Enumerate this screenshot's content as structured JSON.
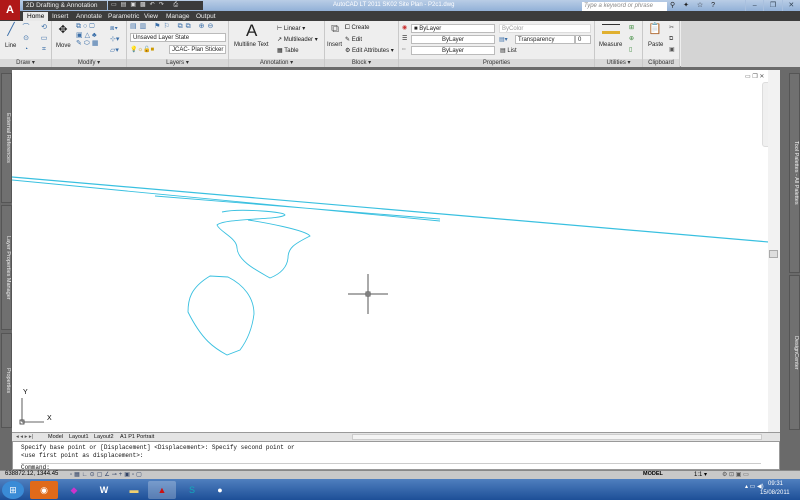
{
  "app": {
    "title": "AutoCAD LT 2011    SK02 Site Plan - P2c1.dwg",
    "workspace": "2D Drafting & Annotation",
    "search_placeholder": "Type a keyword or phrase",
    "app_button": "A"
  },
  "tabs": [
    "Home",
    "Insert",
    "Annotate",
    "Parametric",
    "View",
    "Manage",
    "Output"
  ],
  "active_tab": "Home",
  "panels": {
    "draw": {
      "label": "Draw ▾",
      "line": "Line"
    },
    "modify": {
      "label": "Modify ▾",
      "move": "Move"
    },
    "layers": {
      "label": "Layers ▾",
      "layer_state": "Unsaved Layer State",
      "current_layer": "JCAC- Plan Sticker"
    },
    "annotation": {
      "label": "Annotation ▾",
      "multiline_text": "Multiline Text",
      "linear": "Linear ▾",
      "multileader": "Multileader ▾",
      "table": "Table"
    },
    "block": {
      "label": "Block ▾",
      "insert": "Insert",
      "create": "Create",
      "edit": "Edit",
      "edit_attributes": "Edit Attributes ▾"
    },
    "properties": {
      "label": "Properties",
      "color": "ByLayer",
      "lineweight": "ByLayer",
      "linetype": "ByLayer",
      "plot_style": "ByColor",
      "transparency_label": "Transparency",
      "transparency_value": "0",
      "list": "List"
    },
    "utilities": {
      "label": "Utilities ▾",
      "measure": "Measure"
    },
    "clipboard": {
      "label": "Clipboard",
      "paste": "Paste"
    }
  },
  "palettes": {
    "left": [
      "External References",
      "Layer Properties Manager",
      "Properties"
    ],
    "right": [
      "Tool Palettes - All Palettes",
      "DesignCenter"
    ]
  },
  "ucs": {
    "x": "X",
    "y": "Y"
  },
  "layout_tabs": [
    "Model",
    "Layout1",
    "Layout2",
    "A1 P1 Portrait"
  ],
  "command": {
    "lines": [
      "Specify base point or [Displacement] <Displacement>: Specify second point or",
      "<use first point as displacement>:"
    ],
    "prompt": "Command:"
  },
  "status": {
    "coords": "638872.12, 1344.45",
    "space": "MODEL",
    "annotation_scale": "1:1 ▾"
  },
  "taskbar": {
    "time": "09:31",
    "date": "15/08/2011"
  },
  "colors": {
    "geometry": "#39c0e0",
    "ribbon": "#eeeeee",
    "drawing_bg": "#ffffff"
  }
}
